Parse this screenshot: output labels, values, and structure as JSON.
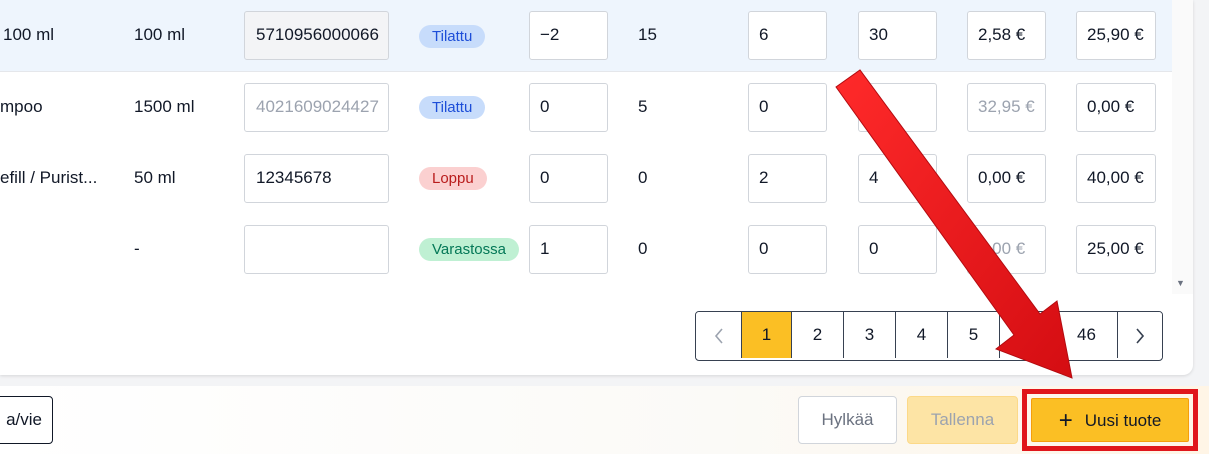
{
  "table": {
    "rows": [
      {
        "name": "100 ml",
        "size": "100 ml",
        "ean": "5710956000066",
        "status": "Tilattu",
        "qty": "−2",
        "stock": "15",
        "a": "6",
        "b": "30",
        "price1": "2,58 €",
        "price2": "25,90 €"
      },
      {
        "name": "mpoo",
        "size": "1500 ml",
        "ean": "4021609024427",
        "status": "Tilattu",
        "qty": "0",
        "stock": "5",
        "a": "0",
        "b": "0",
        "price1": "32,95 €",
        "price2": "0,00 €"
      },
      {
        "name": "efill / Purist...",
        "size": "50 ml",
        "ean": "12345678",
        "status": "Loppu",
        "qty": "0",
        "stock": "0",
        "a": "2",
        "b": "4",
        "price1": "0,00 €",
        "price2": "40,00 €"
      },
      {
        "name": "",
        "size": "-",
        "ean": "",
        "status": "Varastossa",
        "qty": "1",
        "stock": "0",
        "a": "0",
        "b": "0",
        "price1": "0,00 €",
        "price2": "25,00 €"
      }
    ]
  },
  "pagination": {
    "prev_icon": "chevron-left-icon",
    "next_icon": "chevron-right-icon",
    "pages": [
      "1",
      "2",
      "3",
      "4",
      "5",
      "46"
    ],
    "current": "1"
  },
  "footer": {
    "export_label": "a/vie",
    "reject_label": "Hylkää",
    "save_label": "Tallenna",
    "new_product_label": "Uusi tuote",
    "new_product_icon": "plus-icon"
  },
  "colors": {
    "accent": "#fbbf24",
    "annotation_red": "#e0161b",
    "row_highlight": "#eef5fd"
  }
}
